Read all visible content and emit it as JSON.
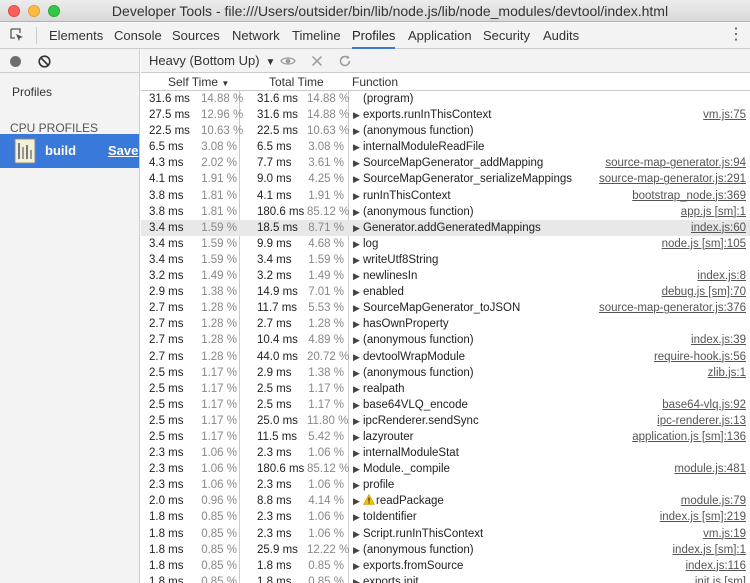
{
  "window": {
    "title": "Developer Tools - file:///Users/outsider/bin/lib/node.js/lib/node_modules/devtool/index.html"
  },
  "tabs": [
    {
      "label": "Elements"
    },
    {
      "label": "Console"
    },
    {
      "label": "Sources"
    },
    {
      "label": "Network"
    },
    {
      "label": "Timeline"
    },
    {
      "label": "Profiles",
      "active": true
    },
    {
      "label": "Application"
    },
    {
      "label": "Security"
    },
    {
      "label": "Audits"
    }
  ],
  "more_icon": "⋮",
  "sidebar": {
    "heading": "Profiles",
    "section": "CPU PROFILES",
    "profile": {
      "name": "build",
      "save": "Save"
    }
  },
  "toolbar": {
    "view": "Heavy (Bottom Up)",
    "view_arrow": "▼"
  },
  "columns": {
    "self": "Self Time",
    "total": "Total Time",
    "function": "Function",
    "sort_arrow": "▼"
  },
  "rows": [
    {
      "sms": "31.6 ms",
      "spct": "14.88 %",
      "tms": "31.6 ms",
      "tpct": "14.88 %",
      "expand": "",
      "fn": "(program)",
      "url": ""
    },
    {
      "sms": "27.5 ms",
      "spct": "12.96 %",
      "tms": "31.6 ms",
      "tpct": "14.88 %",
      "expand": "▶",
      "fn": "exports.runInThisContext",
      "url": "vm.js:75"
    },
    {
      "sms": "22.5 ms",
      "spct": "10.63 %",
      "tms": "22.5 ms",
      "tpct": "10.63 %",
      "expand": "▶",
      "fn": "(anonymous function)",
      "url": ""
    },
    {
      "sms": "6.5 ms",
      "spct": "3.08 %",
      "tms": "6.5 ms",
      "tpct": "3.08 %",
      "expand": "▶",
      "fn": "internalModuleReadFile",
      "url": ""
    },
    {
      "sms": "4.3 ms",
      "spct": "2.02 %",
      "tms": "7.7 ms",
      "tpct": "3.61 %",
      "expand": "▶",
      "fn": "SourceMapGenerator_addMapping",
      "url": "source-map-generator.js:94"
    },
    {
      "sms": "4.1 ms",
      "spct": "1.91 %",
      "tms": "9.0 ms",
      "tpct": "4.25 %",
      "expand": "▶",
      "fn": "SourceMapGenerator_serializeMappings",
      "url": "source-map-generator.js:291"
    },
    {
      "sms": "3.8 ms",
      "spct": "1.81 %",
      "tms": "4.1 ms",
      "tpct": "1.91 %",
      "expand": "▶",
      "fn": "runInThisContext",
      "url": "bootstrap_node.js:369"
    },
    {
      "sms": "3.8 ms",
      "spct": "1.81 %",
      "tms": "180.6 ms",
      "tpct": "85.12 %",
      "expand": "▶",
      "fn": "(anonymous function)",
      "url": "app.js [sm]:1"
    },
    {
      "sms": "3.4 ms",
      "spct": "1.59 %",
      "tms": "18.5 ms",
      "tpct": "8.71 %",
      "expand": "▶",
      "fn": "Generator.addGeneratedMappings",
      "url": "index.js:60",
      "hl": true
    },
    {
      "sms": "3.4 ms",
      "spct": "1.59 %",
      "tms": "9.9 ms",
      "tpct": "4.68 %",
      "expand": "▶",
      "fn": "log",
      "url": "node.js [sm]:105"
    },
    {
      "sms": "3.4 ms",
      "spct": "1.59 %",
      "tms": "3.4 ms",
      "tpct": "1.59 %",
      "expand": "▶",
      "fn": "writeUtf8String",
      "url": ""
    },
    {
      "sms": "3.2 ms",
      "spct": "1.49 %",
      "tms": "3.2 ms",
      "tpct": "1.49 %",
      "expand": "▶",
      "fn": "newlinesIn",
      "url": "index.js:8"
    },
    {
      "sms": "2.9 ms",
      "spct": "1.38 %",
      "tms": "14.9 ms",
      "tpct": "7.01 %",
      "expand": "▶",
      "fn": "enabled",
      "url": "debug.js [sm]:70"
    },
    {
      "sms": "2.7 ms",
      "spct": "1.28 %",
      "tms": "11.7 ms",
      "tpct": "5.53 %",
      "expand": "▶",
      "fn": "SourceMapGenerator_toJSON",
      "url": "source-map-generator.js:376"
    },
    {
      "sms": "2.7 ms",
      "spct": "1.28 %",
      "tms": "2.7 ms",
      "tpct": "1.28 %",
      "expand": "▶",
      "fn": "hasOwnProperty",
      "url": ""
    },
    {
      "sms": "2.7 ms",
      "spct": "1.28 %",
      "tms": "10.4 ms",
      "tpct": "4.89 %",
      "expand": "▶",
      "fn": "(anonymous function)",
      "url": "index.js:39"
    },
    {
      "sms": "2.7 ms",
      "spct": "1.28 %",
      "tms": "44.0 ms",
      "tpct": "20.72 %",
      "expand": "▶",
      "fn": "devtoolWrapModule",
      "url": "require-hook.js:56"
    },
    {
      "sms": "2.5 ms",
      "spct": "1.17 %",
      "tms": "2.9 ms",
      "tpct": "1.38 %",
      "expand": "▶",
      "fn": "(anonymous function)",
      "url": "zlib.js:1"
    },
    {
      "sms": "2.5 ms",
      "spct": "1.17 %",
      "tms": "2.5 ms",
      "tpct": "1.17 %",
      "expand": "▶",
      "fn": "realpath",
      "url": ""
    },
    {
      "sms": "2.5 ms",
      "spct": "1.17 %",
      "tms": "2.5 ms",
      "tpct": "1.17 %",
      "expand": "▶",
      "fn": "base64VLQ_encode",
      "url": "base64-vlq.js:92"
    },
    {
      "sms": "2.5 ms",
      "spct": "1.17 %",
      "tms": "25.0 ms",
      "tpct": "11.80 %",
      "expand": "▶",
      "fn": "ipcRenderer.sendSync",
      "url": "ipc-renderer.js:13"
    },
    {
      "sms": "2.5 ms",
      "spct": "1.17 %",
      "tms": "11.5 ms",
      "tpct": "5.42 %",
      "expand": "▶",
      "fn": "lazyrouter",
      "url": "application.js [sm]:136"
    },
    {
      "sms": "2.3 ms",
      "spct": "1.06 %",
      "tms": "2.3 ms",
      "tpct": "1.06 %",
      "expand": "▶",
      "fn": "internalModuleStat",
      "url": ""
    },
    {
      "sms": "2.3 ms",
      "spct": "1.06 %",
      "tms": "180.6 ms",
      "tpct": "85.12 %",
      "expand": "▶",
      "fn": "Module._compile",
      "url": "module.js:481"
    },
    {
      "sms": "2.3 ms",
      "spct": "1.06 %",
      "tms": "2.3 ms",
      "tpct": "1.06 %",
      "expand": "▶",
      "fn": "profile",
      "url": ""
    },
    {
      "sms": "2.0 ms",
      "spct": "0.96 %",
      "tms": "8.8 ms",
      "tpct": "4.14 %",
      "expand": "▶",
      "fn": "readPackage",
      "url": "module.js:79",
      "warn": true
    },
    {
      "sms": "1.8 ms",
      "spct": "0.85 %",
      "tms": "2.3 ms",
      "tpct": "1.06 %",
      "expand": "▶",
      "fn": "toIdentifier",
      "url": "index.js [sm]:219"
    },
    {
      "sms": "1.8 ms",
      "spct": "0.85 %",
      "tms": "2.3 ms",
      "tpct": "1.06 %",
      "expand": "▶",
      "fn": "Script.runInThisContext",
      "url": "vm.js:19"
    },
    {
      "sms": "1.8 ms",
      "spct": "0.85 %",
      "tms": "25.9 ms",
      "tpct": "12.22 %",
      "expand": "▶",
      "fn": "(anonymous function)",
      "url": "index.js [sm]:1"
    },
    {
      "sms": "1.8 ms",
      "spct": "0.85 %",
      "tms": "1.8 ms",
      "tpct": "0.85 %",
      "expand": "▶",
      "fn": "exports.fromSource",
      "url": "index.js:116"
    },
    {
      "sms": "1.8 ms",
      "spct": "0.85 %",
      "tms": "1.8 ms",
      "tpct": "0.85 %",
      "expand": "▶",
      "fn": "exports.init",
      "url": "init.js [sm]"
    }
  ]
}
